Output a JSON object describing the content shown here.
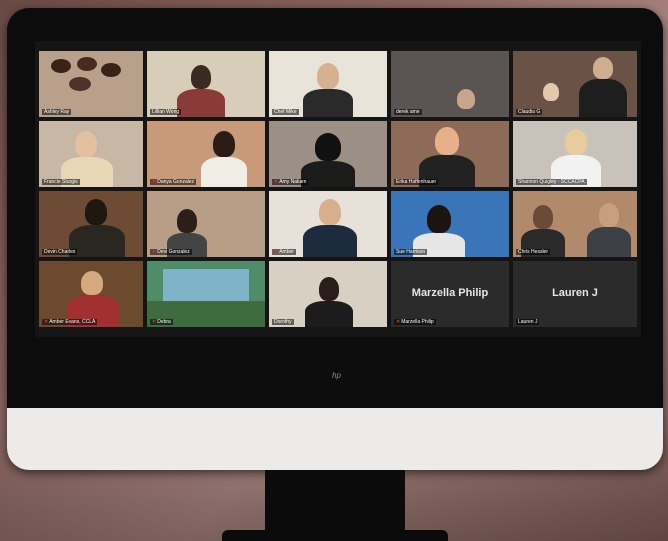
{
  "participants": [
    {
      "name": "Ashley Ray",
      "bg": "#b9a08b"
    },
    {
      "name": "Lillian Wong",
      "bg": "#d8cdb8"
    },
    {
      "name": "Chef Mike",
      "bg": "#e9e4da"
    },
    {
      "name": "derek ame",
      "bg": "#5a5452"
    },
    {
      "name": "Claudia G",
      "bg": "#6a5346"
    },
    {
      "name": "Francie Sturgis",
      "bg": "#c9b7a5"
    },
    {
      "name": "Danya Gonzalez",
      "bg": "#c89a7a"
    },
    {
      "name": "Amy Nakam",
      "bg": "#9b8f86"
    },
    {
      "name": "Erika Haffenhauer",
      "bg": "#8e6b58"
    },
    {
      "name": "Shannon Quigley - SCCACPA",
      "bg": "#c9c2bb"
    },
    {
      "name": "Devin Charles",
      "bg": "#6d4b35"
    },
    {
      "name": "Devi Gonzalez",
      "bg": "#b89e86"
    },
    {
      "name": "Amber",
      "bg": "#e7e1da"
    },
    {
      "name": "Sue Harrison",
      "bg": "#3a74b9"
    },
    {
      "name": "Chris Hessler",
      "bg": "#b08a6b"
    },
    {
      "name": "Amber Evans, CCLA",
      "bg": "#6b4a2d"
    },
    {
      "name": "Debra",
      "bg": "#4f8c68"
    },
    {
      "name": "Dorothy",
      "bg": "#d9d0c4"
    },
    {
      "name": "Marzella Philip",
      "bg": "#2b2b2b",
      "camera_off": true
    },
    {
      "name": "Lauren J",
      "bg": "#2b2b2b",
      "camera_off": true
    }
  ],
  "muted": [
    "Danya Gonzalez",
    "Amy Nakam",
    "Devi Gonzalez",
    "Amber",
    "Amber Evans, CCLA",
    "Debra",
    "Marzella Philip"
  ],
  "monitor_logo": "hp"
}
